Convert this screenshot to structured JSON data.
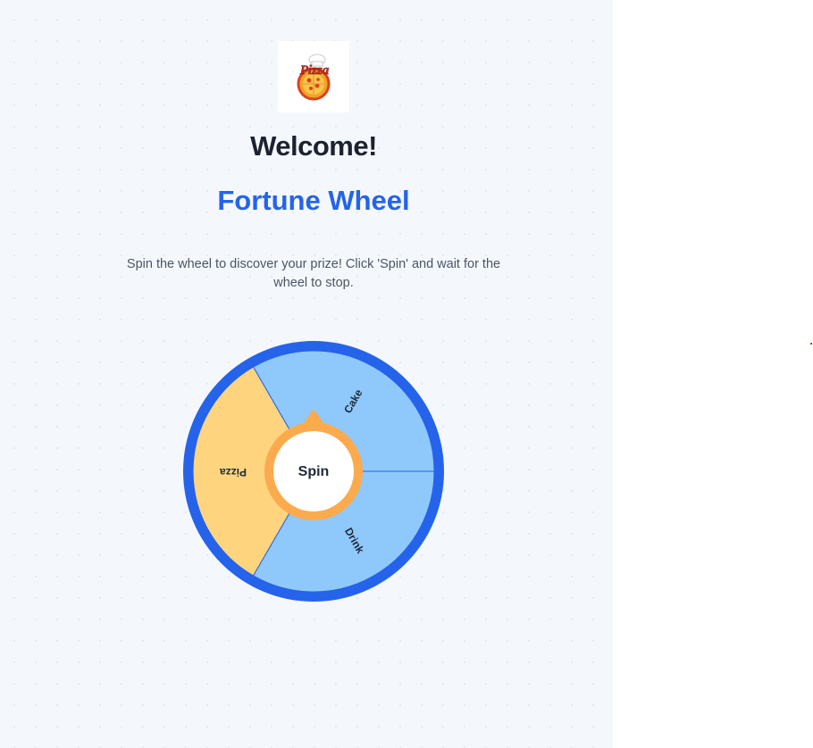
{
  "header": {
    "logo_text": "Pizza",
    "welcome": "Welcome!",
    "title": "Fortune Wheel",
    "description": "Spin the wheel to discover your prize! Click 'Spin' and wait for the wheel to stop."
  },
  "wheel": {
    "spin_label": "Spin",
    "segments": [
      {
        "label": "Cake",
        "color": "#8fc8fb"
      },
      {
        "label": "Drink",
        "color": "#8fc8fb"
      },
      {
        "label": "Pizza",
        "color": "#fed57e"
      }
    ],
    "rim_color": "#2563eb",
    "hub_color": "#fbab4e"
  },
  "colors": {
    "accent": "#2563eb",
    "heading": "#1c222e",
    "panel_bg": "#f4f8fc"
  }
}
